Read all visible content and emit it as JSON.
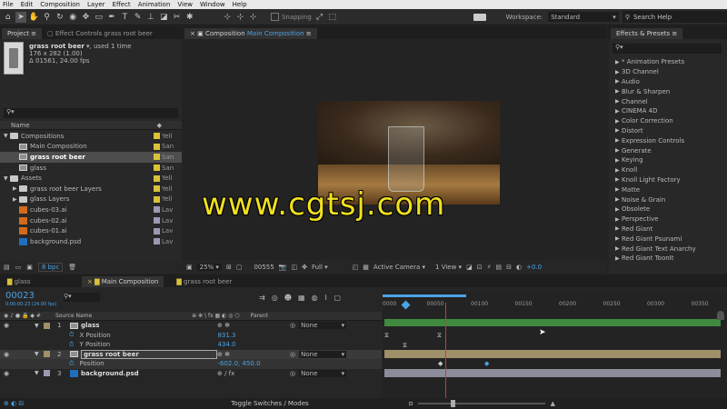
{
  "menu": [
    "File",
    "Edit",
    "Composition",
    "Layer",
    "Effect",
    "Animation",
    "View",
    "Window",
    "Help"
  ],
  "toolbar": {
    "snapping_label": "Snapping",
    "workspace_label": "Workspace:",
    "workspace_value": "Standard",
    "search_help": "Search Help"
  },
  "project_panel": {
    "tab_project": "Project",
    "tab_effect_controls": "Effect Controls grass root beer",
    "item_name": "grass root beer",
    "item_used": ", used 1 time",
    "item_dims": "176 x 282 (1.00)",
    "item_duration": "Δ 01561, 24.00 fps",
    "column_name": "Name",
    "items": [
      {
        "label": "Compositions",
        "type": "folder",
        "indent": 0,
        "expanded": true,
        "swatch": "#d8c23a",
        "col": "Yell"
      },
      {
        "label": "Main Composition",
        "type": "comp",
        "indent": 1,
        "swatch": "#d8c23a",
        "col": "San"
      },
      {
        "label": "grass root beer",
        "type": "comp",
        "indent": 1,
        "swatch": "#d8c23a",
        "col": "San",
        "selected": true
      },
      {
        "label": "glass",
        "type": "comp",
        "indent": 1,
        "swatch": "#d8c23a",
        "col": "San"
      },
      {
        "label": "Assets",
        "type": "folder",
        "indent": 0,
        "expanded": true,
        "swatch": "#d8c23a",
        "col": "Yell"
      },
      {
        "label": "grass root beer Layers",
        "type": "folder",
        "indent": 1,
        "expanded": false,
        "swatch": "#d8c23a",
        "col": "Yell"
      },
      {
        "label": "glass Layers",
        "type": "folder",
        "indent": 1,
        "expanded": false,
        "swatch": "#d8c23a",
        "col": "Yell"
      },
      {
        "label": "cubes-03.ai",
        "type": "ai",
        "indent": 1,
        "swatch": "#9a9ab4",
        "col": "Lav"
      },
      {
        "label": "cubes-02.ai",
        "type": "ai",
        "indent": 1,
        "swatch": "#9a9ab4",
        "col": "Lav"
      },
      {
        "label": "cubes-01.ai",
        "type": "ai",
        "indent": 1,
        "swatch": "#9a9ab4",
        "col": "Lav"
      },
      {
        "label": "background.psd",
        "type": "psd",
        "indent": 1,
        "swatch": "#9a9ab4",
        "col": "Lav"
      }
    ],
    "bpc": "8 bpc"
  },
  "composition_panel": {
    "tab_prefix": "Composition",
    "tab_name": "Main Composition",
    "zoom": "25%",
    "timecode": "00555",
    "quality": "Full",
    "camera": "Active Camera",
    "view": "1 View",
    "exposure": "+0.0"
  },
  "effects_panel": {
    "title": "Effects & Presets",
    "items": [
      "* Animation Presets",
      "3D Channel",
      "Audio",
      "Blur & Sharpen",
      "Channel",
      "CINEMA 4D",
      "Color Correction",
      "Distort",
      "Expression Controls",
      "Generate",
      "Keying",
      "Knoll",
      "Knoll Light Factory",
      "Matte",
      "Noise & Grain",
      "Obsolete",
      "Perspective",
      "Red Giant",
      "Red Giant Psunami",
      "Red Giant Text Anarchy",
      "Red Giant ToonIt"
    ]
  },
  "timeline": {
    "tabs": [
      "glass",
      "Main Composition",
      "grass root beer"
    ],
    "active_tab": 1,
    "current_time": "00023",
    "current_time_sub": "0:00:00:23 (24.00 fps)",
    "col_source_name": "Source Name",
    "col_parent": "Parent",
    "ruler": [
      "0000",
      "00050",
      "00100",
      "00150",
      "00200",
      "00250",
      "00300",
      "00350"
    ],
    "layers": [
      {
        "num": "1",
        "name": "glass",
        "parent": "None",
        "props": [
          {
            "name": "X Position",
            "value": "831.3"
          },
          {
            "name": "Y Position",
            "value": "434.0"
          }
        ]
      },
      {
        "num": "2",
        "name": "grass root beer",
        "parent": "None",
        "selected": true,
        "props": [
          {
            "name": "Position",
            "value": "-602.0, 450.0"
          }
        ]
      },
      {
        "num": "3",
        "name": "background.psd",
        "parent": "None",
        "props": []
      }
    ],
    "toggle_label": "Toggle Switches / Modes"
  },
  "watermark": "www.cgtsj.com",
  "colors": {
    "accent": "#4aa3e6",
    "playhead": "#e0332e",
    "watermark": "#f0e020",
    "layer_green": "#3f8a3f",
    "layer_tan": "#a0906a"
  }
}
